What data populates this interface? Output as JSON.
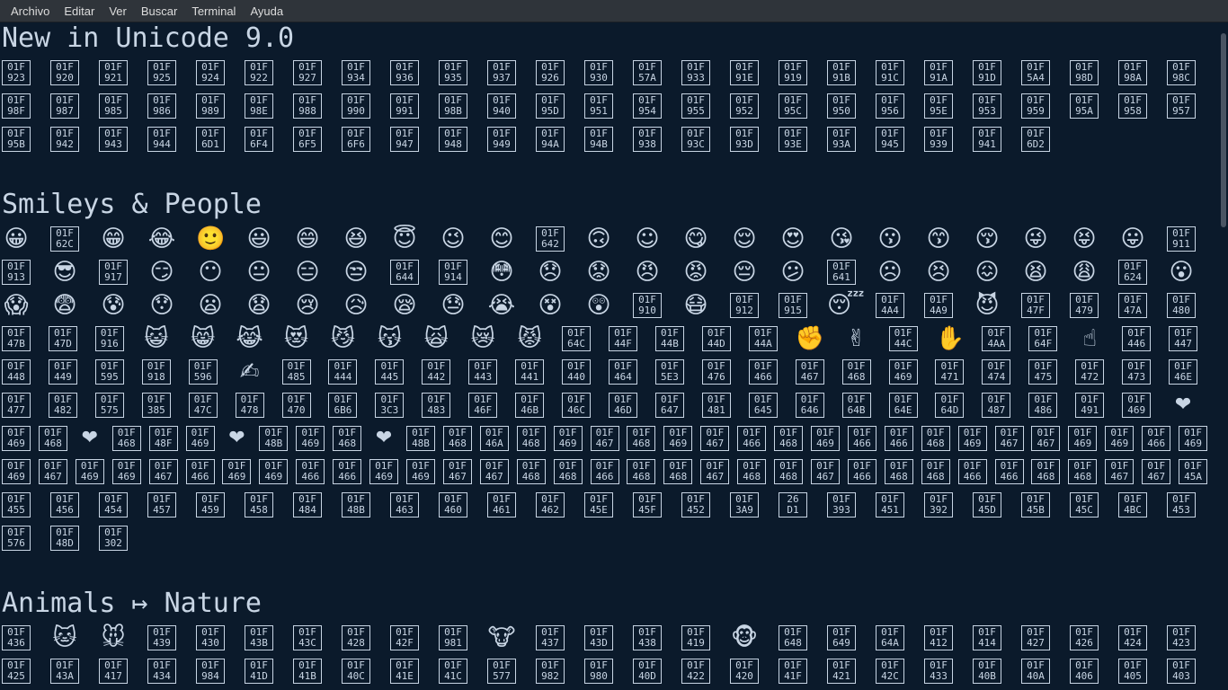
{
  "menubar": {
    "items": [
      "Archivo",
      "Editar",
      "Ver",
      "Buscar",
      "Terminal",
      "Ayuda"
    ]
  },
  "sections": [
    {
      "title": "New in Unicode 9.0",
      "rows": [
        [
          "01F\n923",
          "01F\n920",
          "01F\n921",
          "01F\n925",
          "01F\n924",
          "01F\n922",
          "01F\n927",
          "01F\n934",
          "01F\n936",
          "01F\n935",
          "01F\n937",
          "01F\n926",
          "01F\n930",
          "01F\n57A",
          "01F\n933",
          "01F\n91E",
          "01F\n919",
          "01F\n91B",
          "01F\n91C",
          "01F\n91A",
          "01F\n91D",
          "01F\n5A4",
          "01F\n98D",
          "01F\n98A",
          "01F\n98C"
        ],
        [
          "01F\n98F",
          "01F\n987",
          "01F\n985",
          "01F\n986",
          "01F\n989",
          "01F\n98E",
          "01F\n988",
          "01F\n990",
          "01F\n991",
          "01F\n98B",
          "01F\n940",
          "01F\n95D",
          "01F\n951",
          "01F\n954",
          "01F\n955",
          "01F\n952",
          "01F\n95C",
          "01F\n950",
          "01F\n956",
          "01F\n95E",
          "01F\n953",
          "01F\n959",
          "01F\n95A",
          "01F\n958",
          "01F\n957"
        ],
        [
          "01F\n95B",
          "01F\n942",
          "01F\n943",
          "01F\n944",
          "01F\n6D1",
          "01F\n6F4",
          "01F\n6F5",
          "01F\n6F6",
          "01F\n947",
          "01F\n948",
          "01F\n949",
          "01F\n94A",
          "01F\n94B",
          "01F\n938",
          "01F\n93C",
          "01F\n93D",
          "01F\n93E",
          "01F\n93A",
          "01F\n945",
          "01F\n939",
          "01F\n941",
          "01F\n6D2"
        ]
      ]
    },
    {
      "title": "Smileys & People",
      "rows": [
        [
          "😀",
          "01F\n62C",
          "😁",
          "😂",
          "🙂",
          "😃",
          "😄",
          "😆",
          "😇",
          "😉",
          "😊",
          "01F\n642",
          "🙃",
          "☺",
          "😋",
          "😌",
          "😍",
          "😘",
          "😗",
          "😙",
          "😚",
          "😜",
          "😝",
          "😛",
          "01F\n911"
        ],
        [
          "01F\n913",
          "😎",
          "01F\n917",
          "😏",
          "😶",
          "😐",
          "😑",
          "😒",
          "01F\n644",
          "01F\n914",
          "😳",
          "😞",
          "😟",
          "😠",
          "😡",
          "😔",
          "😕",
          "01F\n641",
          "☹",
          "😣",
          "😖",
          "😫",
          "😩",
          "01F\n624",
          "😮"
        ],
        [
          "😱",
          "😨",
          "😰",
          "😯",
          "😦",
          "😧",
          "😢",
          "😥",
          "😪",
          "😓",
          "😭",
          "😵",
          "😲",
          "01F\n910",
          "😷",
          "01F\n912",
          "01F\n915",
          "😴",
          "01F\n4A4",
          "01F\n4A9",
          "😈",
          "01F\n47F",
          "01F\n479",
          "01F\n47A",
          "01F\n480"
        ],
        [
          "01F\n47B",
          "01F\n47D",
          "01F\n916",
          "😺",
          "😸",
          "😹",
          "😻",
          "😼",
          "😽",
          "🙀",
          "😿",
          "😾",
          "01F\n64C",
          "01F\n44F",
          "01F\n44B",
          "01F\n44D",
          "01F\n44A",
          "✊",
          "✌",
          "01F\n44C",
          "✋",
          "01F\n4AA",
          "01F\n64F",
          "☝",
          "01F\n446",
          "01F\n447"
        ],
        [
          "01F\n448",
          "01F\n449",
          "01F\n595",
          "01F\n918",
          "01F\n596",
          "✍",
          "01F\n485",
          "01F\n444",
          "01F\n445",
          "01F\n442",
          "01F\n443",
          "01F\n441",
          "01F\n440",
          "01F\n464",
          "01F\n5E3",
          "01F\n476",
          "01F\n466",
          "01F\n467",
          "01F\n468",
          "01F\n469",
          "01F\n471",
          "01F\n474",
          "01F\n475",
          "01F\n472",
          "01F\n473",
          "01F\n46E"
        ],
        [
          "01F\n477",
          "01F\n482",
          "01F\n575",
          "01F\n385",
          "01F\n47C",
          "01F\n478",
          "01F\n470",
          "01F\n6B6",
          "01F\n3C3",
          "01F\n483",
          "01F\n46F",
          "01F\n46B",
          "01F\n46C",
          "01F\n46D",
          "01F\n647",
          "01F\n481",
          "01F\n645",
          "01F\n646",
          "01F\n64B",
          "01F\n64E",
          "01F\n64D",
          "01F\n487",
          "01F\n486",
          "01F\n491",
          "01F\n469",
          "❤"
        ],
        [
          "01F\n469",
          "01F\n468",
          "❤",
          "01F\n468",
          "01F\n48F",
          "01F\n469",
          "❤",
          "01F\n48B",
          "01F\n469",
          "01F\n468",
          "❤",
          "01F\n48B",
          "01F\n468",
          "01F\n46A",
          "01F\n468",
          "01F\n469",
          "01F\n467",
          "01F\n468",
          "01F\n469",
          "01F\n467",
          "01F\n466",
          "01F\n468",
          "01F\n469",
          "01F\n466",
          "01F\n466",
          "01F\n468",
          "01F\n469",
          "01F\n467",
          "01F\n467",
          "01F\n469",
          "01F\n469",
          "01F\n466",
          "01F\n469"
        ],
        [
          "01F\n469",
          "01F\n467",
          "01F\n469",
          "01F\n469",
          "01F\n467",
          "01F\n466",
          "01F\n469",
          "01F\n469",
          "01F\n466",
          "01F\n466",
          "01F\n469",
          "01F\n469",
          "01F\n467",
          "01F\n467",
          "01F\n468",
          "01F\n468",
          "01F\n466",
          "01F\n468",
          "01F\n468",
          "01F\n467",
          "01F\n468",
          "01F\n468",
          "01F\n467",
          "01F\n466",
          "01F\n468",
          "01F\n468",
          "01F\n466",
          "01F\n466",
          "01F\n468",
          "01F\n468",
          "01F\n467",
          "01F\n467",
          "01F\n45A"
        ],
        [
          "01F\n455",
          "01F\n456",
          "01F\n454",
          "01F\n457",
          "01F\n459",
          "01F\n458",
          "01F\n484",
          "01F\n48B",
          "01F\n463",
          "01F\n460",
          "01F\n461",
          "01F\n462",
          "01F\n45E",
          "01F\n45F",
          "01F\n452",
          "01F\n3A9",
          "26\nD1",
          "01F\n393",
          "01F\n451",
          "01F\n392",
          "01F\n45D",
          "01F\n45B",
          "01F\n45C",
          "01F\n4BC",
          "01F\n453"
        ],
        [
          "01F\n576",
          "01F\n48D",
          "01F\n302"
        ]
      ]
    },
    {
      "title": "Animals ↦ Nature",
      "rows": [
        [
          "01F\n436",
          "🐱",
          "🐭",
          "01F\n439",
          "01F\n430",
          "01F\n43B",
          "01F\n43C",
          "01F\n428",
          "01F\n42F",
          "01F\n981",
          "🐮",
          "01F\n437",
          "01F\n43D",
          "01F\n438",
          "01F\n419",
          "🐵",
          "01F\n648",
          "01F\n649",
          "01F\n64A",
          "01F\n412",
          "01F\n414",
          "01F\n427",
          "01F\n426",
          "01F\n424",
          "01F\n423"
        ],
        [
          "01F\n425",
          "01F\n43A",
          "01F\n417",
          "01F\n434",
          "01F\n984",
          "01F\n41D",
          "01F\n41B",
          "01F\n40C",
          "01F\n41E",
          "01F\n41C",
          "01F\n577",
          "01F\n982",
          "01F\n980",
          "01F\n40D",
          "01F\n422",
          "01F\n420",
          "01F\n41F",
          "01F\n421",
          "01F\n42C",
          "01F\n433",
          "01F\n40B",
          "01F\n40A",
          "01F\n406",
          "01F\n405",
          "01F\n403"
        ]
      ]
    }
  ],
  "colors": {
    "background": "#0b1a2b",
    "foreground": "#c8d5e4",
    "menubar": "#2f343a"
  }
}
